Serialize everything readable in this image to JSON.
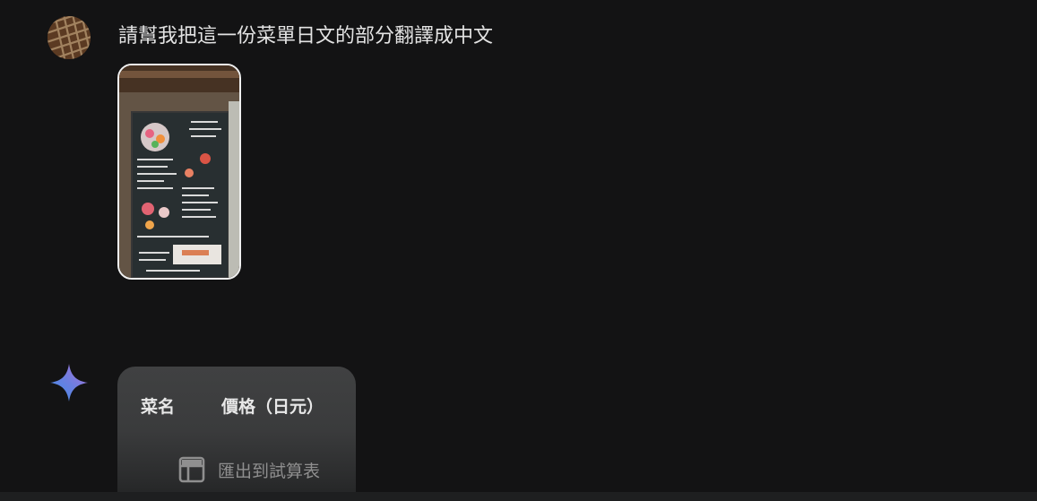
{
  "user_message": {
    "text": "請幫我把這一份菜單日文的部分翻譯成中文",
    "avatar_icon": "user-avatar",
    "attachment_icon": "menu-photo-thumbnail"
  },
  "response": {
    "icon": "gemini-sparkle-icon",
    "table_headers": [
      "菜名",
      "價格（日元）"
    ],
    "export_label": "匯出到試算表",
    "export_icon": "table-icon"
  },
  "colors": {
    "background": "#131314",
    "card": "#3c3d3e",
    "text": "#e3e3e3",
    "muted": "#8f8f8f"
  }
}
